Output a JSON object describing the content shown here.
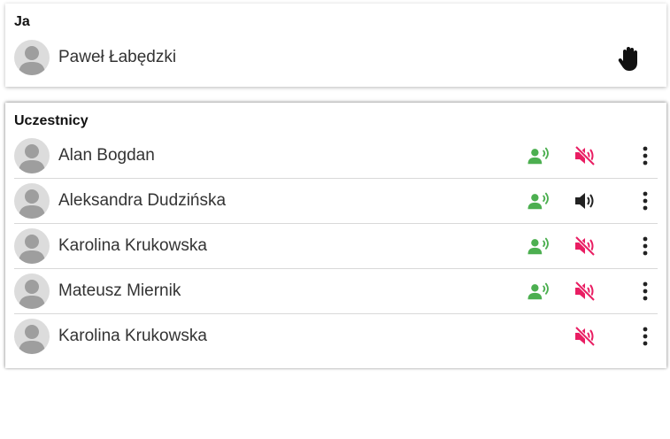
{
  "me": {
    "title": "Ja",
    "name": "Paweł Łabędzki",
    "hand_icon": "raise-hand-icon"
  },
  "participants": {
    "title": "Uczestnicy",
    "items": [
      {
        "name": "Alan Bogdan",
        "mic": "speaking",
        "audio": "muted"
      },
      {
        "name": "Aleksandra Dudzińska",
        "mic": "speaking",
        "audio": "on"
      },
      {
        "name": "Karolina Krukowska",
        "mic": "speaking",
        "audio": "muted"
      },
      {
        "name": "Mateusz Miernik",
        "mic": "speaking",
        "audio": "muted"
      },
      {
        "name": "Karolina Krukowska",
        "mic": "none",
        "audio": "muted"
      }
    ]
  },
  "colors": {
    "speaking_green": "#4caf50",
    "muted_red": "#e91e63",
    "speaker_dark": "#222222",
    "menu_dark": "#222222",
    "avatar_bg": "#dcdcdc",
    "avatar_fg": "#9e9e9e"
  }
}
